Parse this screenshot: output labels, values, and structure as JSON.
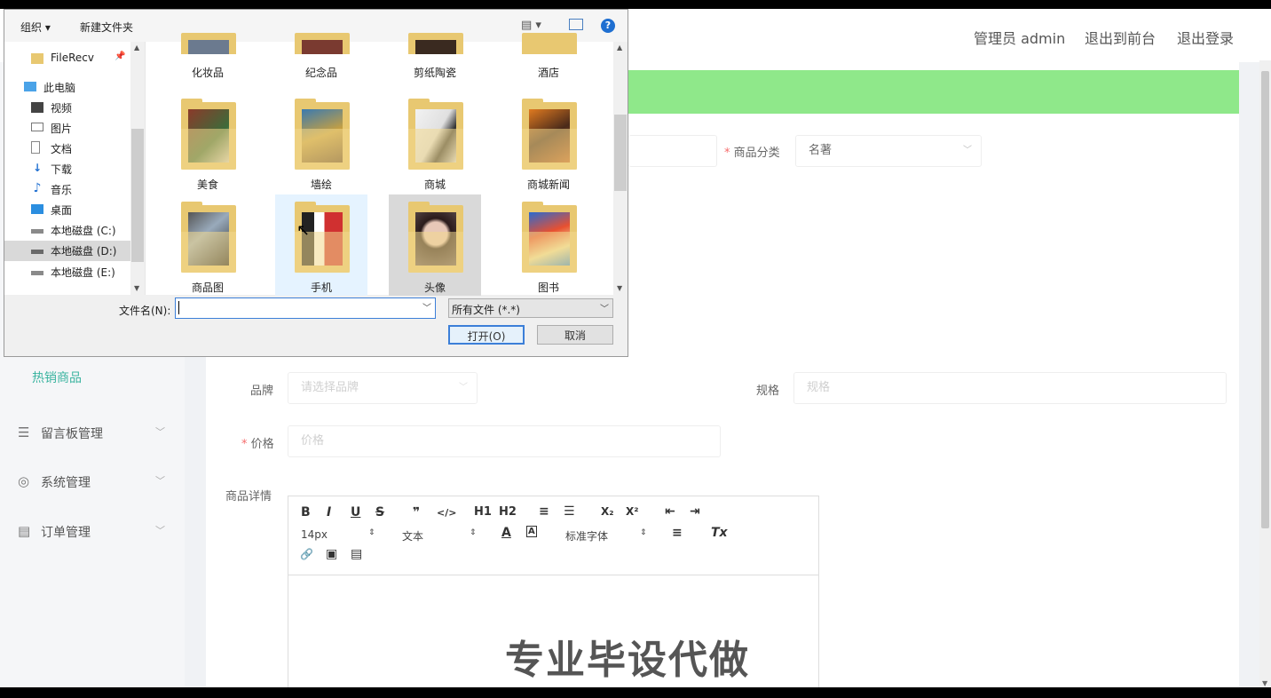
{
  "topbar": {
    "admin_label": "管理员 admin",
    "exit_front_label": "退出到前台",
    "logout_label": "退出登录"
  },
  "sidebar": {
    "partial_item": "热销商品",
    "items": [
      {
        "icon": "list-icon",
        "label": "留言板管理"
      },
      {
        "icon": "globe-icon",
        "label": "系统管理"
      },
      {
        "icon": "clipboard-icon",
        "label": "订单管理"
      }
    ]
  },
  "form": {
    "category_label": "商品分类",
    "category_value": "名著",
    "brand_label": "品牌",
    "brand_placeholder": "请选择品牌",
    "spec_label": "规格",
    "spec_placeholder": "规格",
    "price_label": "价格",
    "price_placeholder": "价格",
    "detail_label": "商品详情"
  },
  "editor": {
    "font_size": "14px",
    "heading_select": "文本",
    "font_family": "标准字体",
    "watermark": "专业毕设代做",
    "buttons": {
      "bold": "B",
      "italic": "I",
      "underline": "U",
      "strike": "S",
      "quote": "❞",
      "code": "</>",
      "h1": "H1",
      "h2": "H2",
      "ol": "≡",
      "ul": "☰",
      "sub": "X₂",
      "sup": "X²",
      "outdent": "⇤",
      "indent": "⇥",
      "color": "A",
      "bg": "A",
      "align": "≡",
      "clear": "Tx",
      "link": "🔗",
      "image": "▣",
      "video": "▤"
    }
  },
  "dialog": {
    "organize_label": "组织 ▾",
    "new_folder_label": "新建文件夹",
    "nav_items": [
      {
        "icon": "folder-icon",
        "label": "FileRecv"
      },
      {
        "icon": "computer-icon",
        "label": "此电脑"
      },
      {
        "icon": "video-icon",
        "label": "视频"
      },
      {
        "icon": "picture-icon",
        "label": "图片"
      },
      {
        "icon": "document-icon",
        "label": "文档"
      },
      {
        "icon": "download-icon",
        "label": "下载"
      },
      {
        "icon": "music-icon",
        "label": "音乐"
      },
      {
        "icon": "desktop-icon",
        "label": "桌面"
      },
      {
        "icon": "drive-icon",
        "label": "本地磁盘 (C:)"
      },
      {
        "icon": "drive-icon",
        "label": "本地磁盘 (D:)"
      },
      {
        "icon": "drive-icon",
        "label": "本地磁盘 (E:)"
      }
    ],
    "folders_row1": [
      "化妆品",
      "纪念品",
      "剪纸陶瓷",
      "酒店"
    ],
    "folders_row2": [
      "美食",
      "墙绘",
      "商城",
      "商城新闻"
    ],
    "folders_row3": [
      "商品图",
      "手机",
      "头像",
      "图书"
    ],
    "filename_label": "文件名(N):",
    "filename_value": "",
    "filetype_value": "所有文件 (*.*)",
    "open_label": "打开(O)",
    "cancel_label": "取消"
  },
  "colors": {
    "accent_green": "#8fe88a",
    "active_menu": "#3bb4a0",
    "selected_tile": "#cce8ff",
    "hover_tile": "#d9d9d9"
  }
}
